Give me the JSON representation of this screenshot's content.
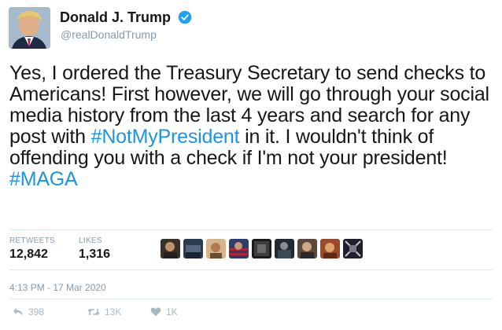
{
  "header": {
    "display_name": "Donald J. Trump",
    "handle": "@realDonaldTrump"
  },
  "tweet": {
    "segments": [
      {
        "text": "Yes, I ordered the Treasury Secretary to send checks to Americans! First however, we will go through your social media history from the last 4 years and search for any post with ",
        "link": false
      },
      {
        "text": "#NotMyPresident",
        "link": true
      },
      {
        "text": " in it. I wouldn't think of offending you with a check if I'm not your president! ",
        "link": false
      },
      {
        "text": "#MAGA",
        "link": true
      }
    ]
  },
  "stats": {
    "retweets_label": "RETWEETS",
    "retweets_value": "12,842",
    "likes_label": "LIKES",
    "likes_value": "1,316"
  },
  "likers_count_shown": 9,
  "timestamp": "4:13 PM - 17 Mar 2020",
  "actions": {
    "reply_count": "398",
    "retweet_count": "13K",
    "like_count": "1K"
  },
  "colors": {
    "link": "#1b95e0",
    "verified": "#1da1f2",
    "muted": "#8899a6"
  }
}
